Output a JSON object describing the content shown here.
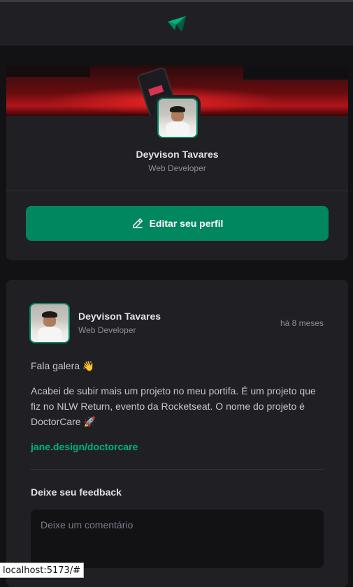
{
  "header": {
    "logo_icon": "ignite-logo-icon"
  },
  "profile": {
    "name": "Deyvison Tavares",
    "role": "Web Developer",
    "edit_label": "Editar seu perfil",
    "edit_icon": "pencil-icon"
  },
  "post": {
    "author_name": "Deyvison Tavares",
    "author_role": "Web Developer",
    "time": "há 8 meses",
    "greeting": "Fala galera 👋",
    "content": "Acabei de subir mais um projeto no meu portifa. É um projeto que fiz no NLW Return, evento da Rocketseat. O nome do projeto é DoctorCare 🚀",
    "link": "jane.design/doctorcare"
  },
  "feedback": {
    "title": "Deixe seu feedback",
    "placeholder": "Deixe um comentário"
  },
  "status_bar": {
    "url": "localhost:5173/#"
  },
  "colors": {
    "accent": "#00875f",
    "link": "#00b37e",
    "background": "#121214",
    "card": "#202024"
  }
}
